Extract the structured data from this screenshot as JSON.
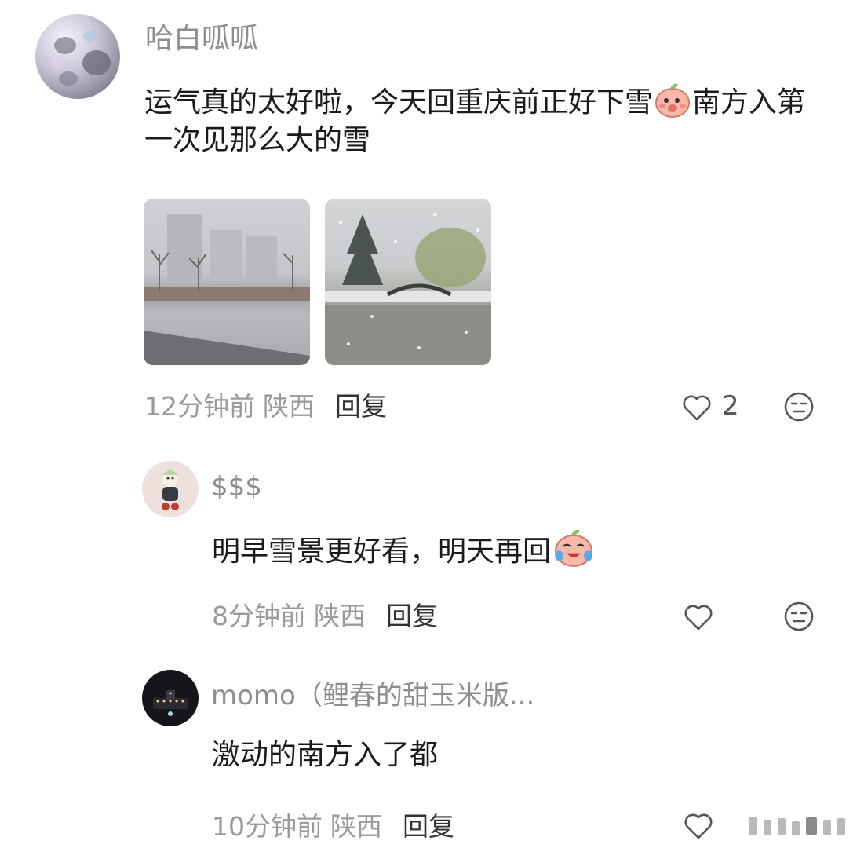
{
  "comments": [
    {
      "username": "哈白呱呱",
      "text_part1": "运气真的太好啦，今天回重庆前正好下雪",
      "text_part2": "南方入第一次见那么大的雪",
      "time": "12分钟前",
      "region": "陕西",
      "reply_label": "回复",
      "likes": "2",
      "avatar_icon": "chrome-orb-avatar",
      "images": [
        {
          "name": "snowy-plaza-photo"
        },
        {
          "name": "snowy-lake-photo"
        }
      ],
      "emoji": "peach-shy-emoji"
    }
  ],
  "replies": [
    {
      "username": "$$$",
      "text": "明早雪景更好看，明天再回",
      "time": "8分钟前",
      "region": "陕西",
      "reply_label": "回复",
      "avatar_icon": "toy-doll-avatar",
      "emoji": "peach-crying-laugh-emoji"
    },
    {
      "username": "momo（鲤春的甜玉米版...",
      "text": "激动的南方入了都",
      "time": "10分钟前",
      "region": "陕西",
      "reply_label": "回复",
      "avatar_icon": "night-building-avatar"
    }
  ],
  "icons": {
    "like": "heart-outline-icon",
    "dislike": "neutral-face-icon"
  },
  "colors": {
    "meta": "#9a9a9a",
    "username": "#8e8e8e",
    "text": "#1a1a1a"
  }
}
